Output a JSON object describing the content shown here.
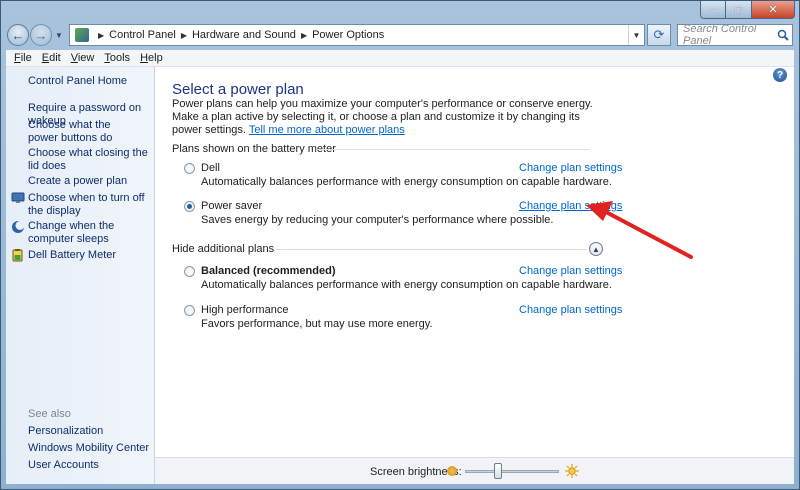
{
  "window": {
    "minimize_glyph": "–",
    "maximize_glyph": "□",
    "close_glyph": "✕"
  },
  "address_bar": {
    "crumbs": [
      "Control Panel",
      "Hardware and Sound",
      "Power Options"
    ],
    "search_placeholder": "Search Control Panel"
  },
  "menu": {
    "items": [
      {
        "key": "F",
        "rest": "ile"
      },
      {
        "key": "E",
        "rest": "dit"
      },
      {
        "key": "V",
        "rest": "iew"
      },
      {
        "key": "T",
        "rest": "ools"
      },
      {
        "key": "H",
        "rest": "elp"
      }
    ]
  },
  "sidebar": {
    "home": "Control Panel Home",
    "tasks": [
      "Require a password on wakeup",
      "Choose what the power buttons do",
      "Choose what closing the lid does",
      "Create a power plan",
      "Choose when to turn off the display",
      "Change when the computer sleeps",
      "Dell Battery Meter"
    ],
    "see_also_label": "See also",
    "see_also": [
      "Personalization",
      "Windows Mobility Center",
      "User Accounts"
    ]
  },
  "main": {
    "title": "Select a power plan",
    "description": "Power plans can help you maximize your computer's performance or conserve energy. Make a plan active by selecting it, or choose a plan and customize it by changing its power settings.",
    "tell_me_more": "Tell me more about power plans",
    "battery_section": "Plans shown on the battery meter",
    "hidden_section": "Hide additional plans",
    "change_link": "Change plan settings",
    "plans": [
      {
        "name": "Dell",
        "desc": "Automatically balances performance with energy consumption on capable hardware.",
        "selected": false
      },
      {
        "name": "Power saver",
        "desc": "Saves energy by reducing your computer's performance where possible.",
        "selected": true
      },
      {
        "name": "Balanced (recommended)",
        "desc": "Automatically balances performance with energy consumption on capable hardware.",
        "selected": false
      },
      {
        "name": "High performance",
        "desc": "Favors performance, but may use more energy.",
        "selected": false
      }
    ]
  },
  "bottom": {
    "brightness_label": "Screen brightness:",
    "brightness_level": 0.35
  },
  "colors": {
    "link": "#0066cc",
    "title": "#1e3287",
    "arrow": "#e0231e"
  }
}
